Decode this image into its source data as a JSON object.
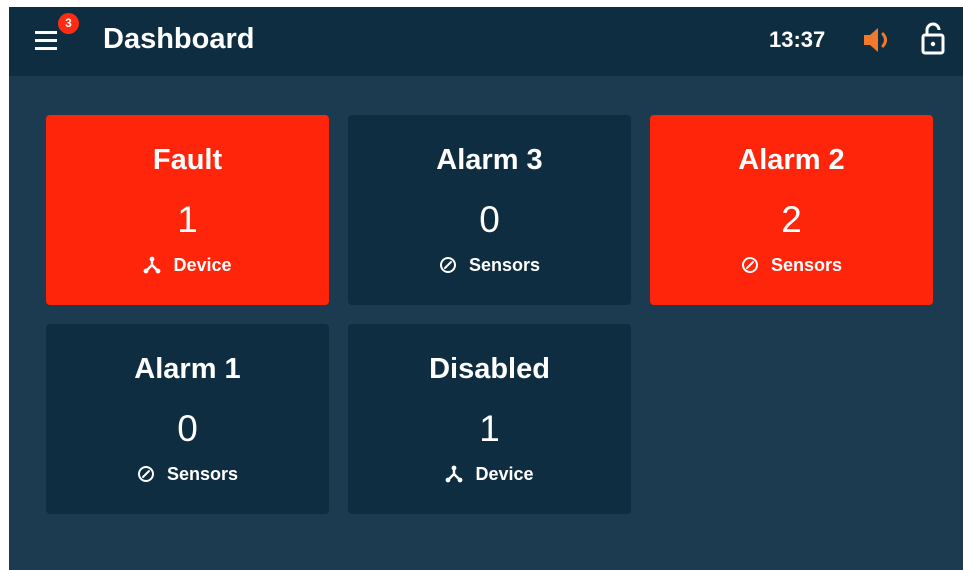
{
  "header": {
    "title": "Dashboard",
    "menu_icon": "hamburger-menu-icon",
    "menu_badge": "3",
    "time": "13:37",
    "sound_icon": "speaker-icon",
    "lock_icon": "lock-icon"
  },
  "colors": {
    "background": "#1c3b51",
    "header": "#0f2d40",
    "card_normal": "#0f2d40",
    "card_alert": "#ff250b",
    "accent": "#f07a2a",
    "badge": "#ff2b12"
  },
  "cards": [
    {
      "title": "Fault",
      "count": "1",
      "unit": "Device",
      "icon": "device-network-icon",
      "state": "alert"
    },
    {
      "title": "Alarm 3",
      "count": "0",
      "unit": "Sensors",
      "icon": "gauge-icon",
      "state": "normal"
    },
    {
      "title": "Alarm 2",
      "count": "2",
      "unit": "Sensors",
      "icon": "gauge-icon",
      "state": "alert"
    },
    {
      "title": "Alarm 1",
      "count": "0",
      "unit": "Sensors",
      "icon": "gauge-icon",
      "state": "normal"
    },
    {
      "title": "Disabled",
      "count": "1",
      "unit": "Device",
      "icon": "device-network-icon",
      "state": "normal"
    }
  ]
}
